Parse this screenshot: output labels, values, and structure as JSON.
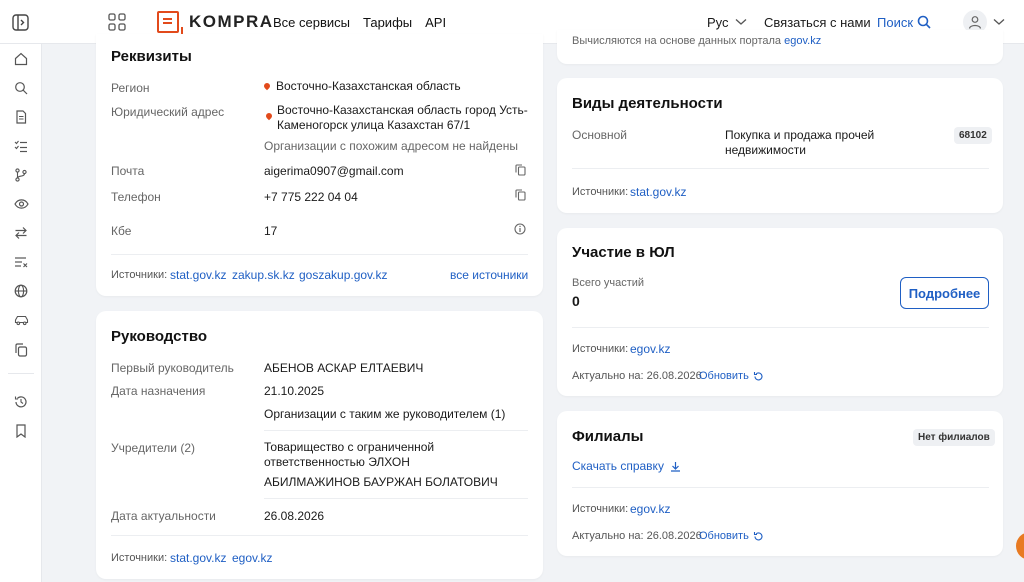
{
  "header": {
    "logo_text": "KOMPRA",
    "nav": [
      "Все сервисы",
      "Тарифы",
      "API"
    ],
    "lang": "Рус",
    "contact": "Связаться с нами",
    "search": "Поиск"
  },
  "rekvizity": {
    "title": "Реквизиты",
    "top_clip": "Вычисляются на основе данных портала",
    "region_label": "Регион",
    "region_value": "Восточно-Казахстанская область",
    "address_label": "Юридический адрес",
    "address_value": "Восточно-Казахстанская область город Усть-Каменогорск улица Казахстан 67/1",
    "address_note": "Организации с похожим адресом не найдены",
    "email_label": "Почта",
    "email_value": "aigerima0907@gmail.com",
    "phone_label": "Телефон",
    "phone_value": "+7 775 222 04 04",
    "kbe_label": "Кбе",
    "kbe_value": "17",
    "sources_label": "Источники:",
    "sources": [
      "stat.gov.kz",
      "zakup.sk.kz",
      "goszakup.gov.kz"
    ],
    "all_sources": "все источники"
  },
  "rukovodstvo": {
    "title": "Руководство",
    "head_label": "Первый руководитель",
    "head_value": "АБЕНОВ АСКАР ЕЛТАЕВИЧ",
    "date_label": "Дата назначения",
    "date_value": "21.10.2025",
    "same_head_link": "Организации с таким же руководителем (1)",
    "founders_label": "Учредители (2)",
    "founder1": "Товарищество с ограниченной ответственностью ЭЛХОН",
    "founder2": "АБИЛМАЖИНОВ БАУРЖАН БОЛАТОВИЧ",
    "actual_label": "Дата актуальности",
    "actual_value": "26.08.2026",
    "sources_label": "Источники:",
    "sources": [
      "stat.gov.kz",
      "egov.kz"
    ]
  },
  "top_right": {
    "clip_text": "Вычисляются на основе данных портала",
    "clip_link": "egov.kz"
  },
  "vidy": {
    "title": "Виды деятельности",
    "main_label": "Основной",
    "main_value": "Покупка и продажа прочей недвижимости",
    "code": "68102",
    "sources_label": "Источники:",
    "source": "stat.gov.kz"
  },
  "uchastie": {
    "title": "Участие в ЮЛ",
    "total_label": "Всего участий",
    "total_value": "0",
    "more_button": "Подробнее",
    "sources_label": "Источники:",
    "source": "egov.kz",
    "actual_label": "Актуально на: 26.08.2026",
    "refresh": "Обновить"
  },
  "filialy": {
    "title": "Филиалы",
    "badge": "Нет филиалов",
    "download": "Скачать справку",
    "sources_label": "Источники:",
    "source": "egov.kz",
    "actual_label": "Актуально на: 26.08.2026",
    "refresh": "Обновить"
  }
}
